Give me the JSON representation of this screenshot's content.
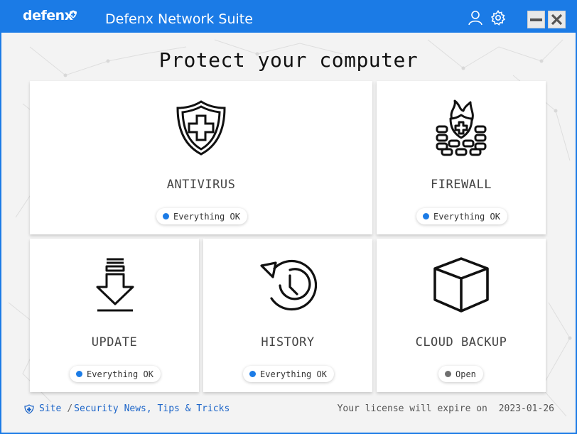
{
  "titlebar": {
    "logo": "defenx",
    "title": "Defenx Network Suite",
    "icons": [
      "user-icon",
      "gear-icon"
    ],
    "minimize": "minimize-icon",
    "close": "close-icon"
  },
  "main": {
    "heading": "Protect your computer",
    "cards": [
      {
        "label": "ANTIVIRUS",
        "icon": "shield-plus-icon",
        "status": "Everything OK",
        "status_color": "#1b7be6"
      },
      {
        "label": "FIREWALL",
        "icon": "firewall-icon",
        "status": "Everything OK",
        "status_color": "#1b7be6"
      },
      {
        "label": "UPDATE",
        "icon": "download-icon",
        "status": "Everything OK",
        "status_color": "#1b7be6"
      },
      {
        "label": "HISTORY",
        "icon": "history-icon",
        "status": "Everything OK",
        "status_color": "#1b7be6"
      },
      {
        "label": "CLOUD BACKUP",
        "icon": "cube-icon",
        "status": "Open",
        "status_color": "#6f6f6f"
      }
    ]
  },
  "footer": {
    "site": "Site",
    "separator": "/",
    "news": "Security News, Tips & Tricks",
    "license_text": "Your license will expire on",
    "license_date": "2023-01-26"
  },
  "colors": {
    "accent": "#1b7be6",
    "background": "#f3f3f3",
    "card": "#ffffff"
  }
}
